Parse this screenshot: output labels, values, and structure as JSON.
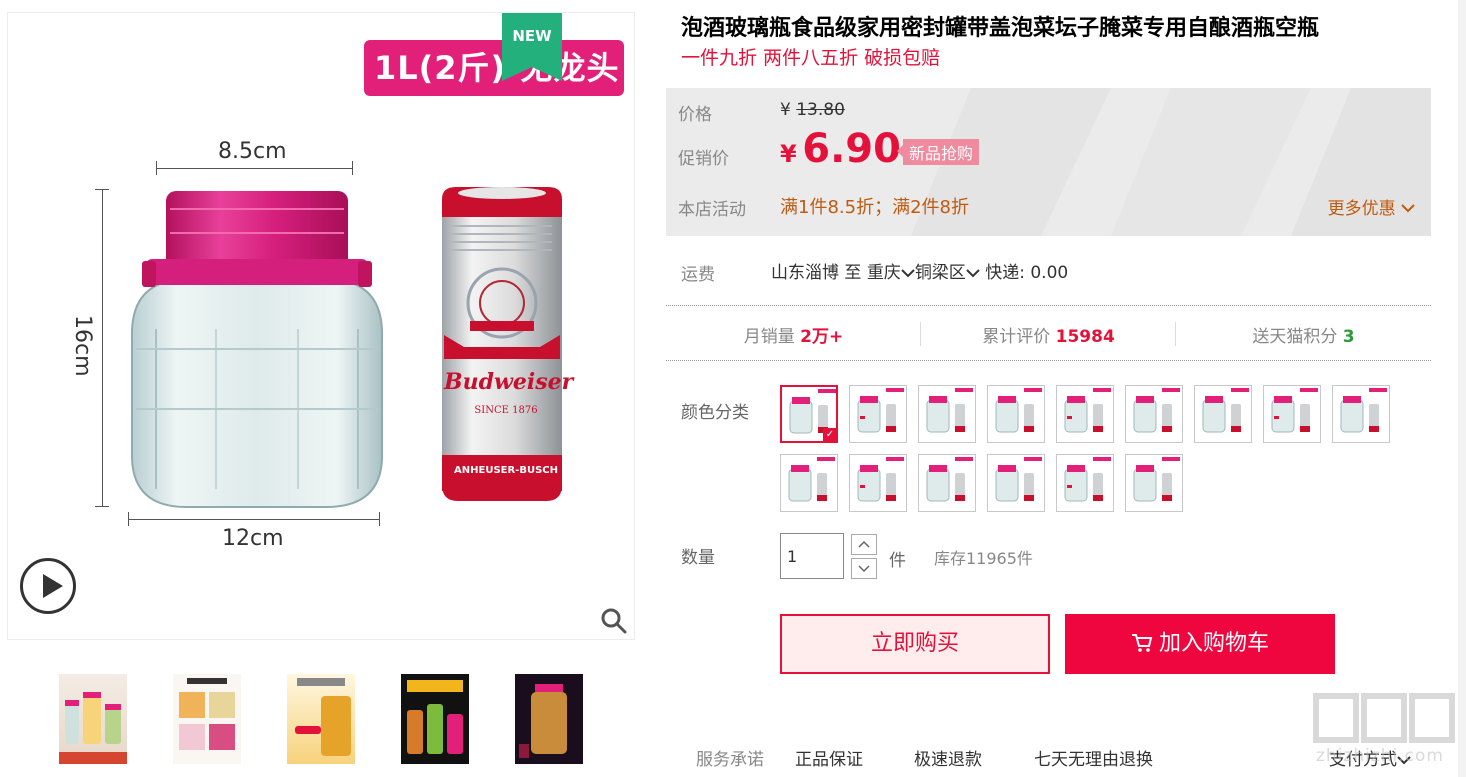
{
  "gallery": {
    "banner_text": "1L(2斤)-无龙头",
    "new_badge": "NEW",
    "dim_top": "8.5cm",
    "dim_side": "16cm",
    "dim_bottom": "12cm",
    "can_brand": "Budweiser",
    "can_since": "SINCE 1876",
    "can_maker": "ANHEUSER-BUSCH",
    "thumbnail_count": 5
  },
  "product": {
    "title": "泡酒玻璃瓶食品级家用密封罐带盖泡菜坛子腌菜专用自酿酒瓶空瓶",
    "subtitle": "一件九折 两件八五折 破损包赔"
  },
  "price": {
    "price_label": "价格",
    "currency": "¥",
    "original": "13.80",
    "promo_label": "促销价",
    "promo": "6.90",
    "promo_tag": "新品抢购",
    "activity_label": "本店活动",
    "activity_text": "满1件8.5折；满2件8折",
    "more_deals": "更多优惠"
  },
  "shipping": {
    "label": "运费",
    "from": "山东淄博",
    "to_word": "至",
    "city": "重庆",
    "district": "铜梁区",
    "method": "快递: 0.00"
  },
  "stats": {
    "monthly_label": "月销量",
    "monthly_value": "2万+",
    "reviews_label": "累计评价",
    "reviews_value": "15984",
    "points_label": "送天猫积分",
    "points_value": "3"
  },
  "options": {
    "color_label": "颜色分类",
    "swatch_count": 15,
    "selected_index": 0
  },
  "quantity": {
    "label": "数量",
    "value": "1",
    "unit": "件",
    "stock": "库存11965件"
  },
  "actions": {
    "buy_now": "立即购买",
    "add_to_cart": "加入购物车"
  },
  "service": {
    "label": "服务承诺",
    "items": [
      "正品保证",
      "极速退款",
      "七天无理由退换"
    ],
    "payment": "支付方式"
  },
  "watermark": {
    "text": "zhizhizhi.com"
  },
  "colors": {
    "accent": "#e4123b",
    "cart_button": "#f0063f",
    "lid_pink": "#e2207a",
    "activity_orange": "#c05a0f",
    "new_badge_green": "#23b07d"
  }
}
